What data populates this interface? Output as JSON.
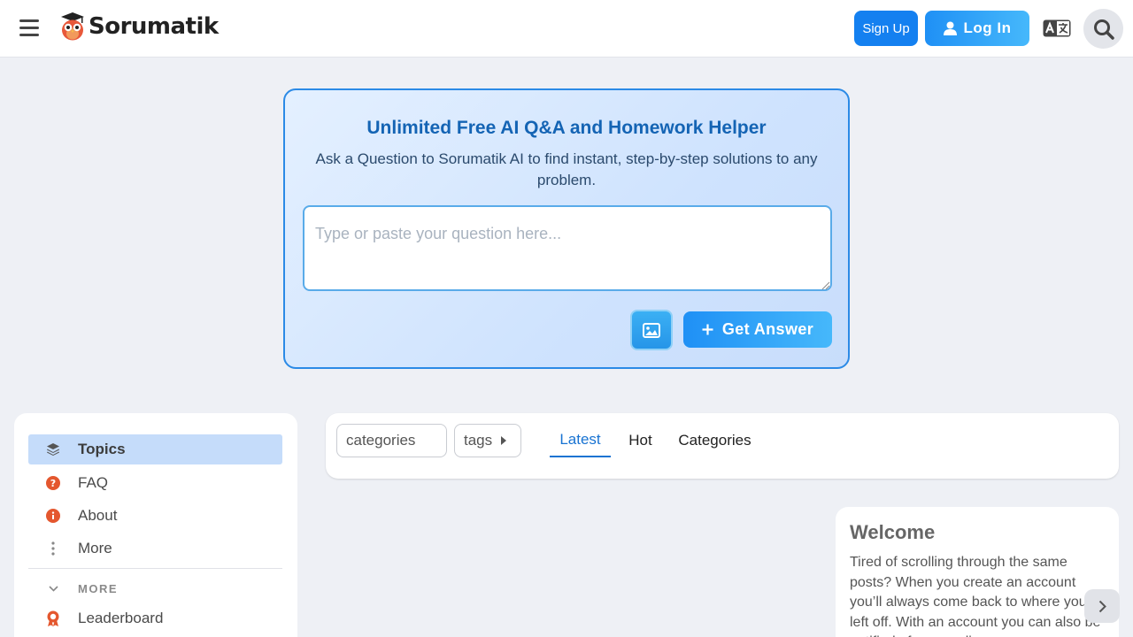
{
  "header": {
    "brand": "Sorumatik",
    "signup_label": "Sign Up",
    "login_label": "Log In",
    "icons": [
      "menu-icon",
      "owl-logo-icon",
      "user-icon",
      "translate-icon",
      "search-icon"
    ]
  },
  "hero": {
    "title": "Unlimited Free AI Q&A and Homework Helper",
    "subtitle": "Ask a Question to Sorumatik AI to find instant, step-by-step solutions to any problem.",
    "placeholder": "Type or paste your question here...",
    "value": "",
    "answer_label": "Get Answer",
    "icons": [
      "image-icon",
      "plus-icon"
    ]
  },
  "sidebar": {
    "items": [
      {
        "label": "Topics",
        "icon": "layers-icon",
        "active": true
      },
      {
        "label": "FAQ",
        "icon": "question-circle-icon"
      },
      {
        "label": "About",
        "icon": "info-circle-icon"
      },
      {
        "label": "More",
        "icon": "vertical-dots-icon"
      }
    ],
    "more_section_label": "MORE",
    "more_items": [
      {
        "label": "Leaderboard",
        "icon": "award-icon"
      }
    ]
  },
  "filters": {
    "categories_label": "categories",
    "tags_label": "tags",
    "tabs": [
      {
        "label": "Latest",
        "active": true
      },
      {
        "label": "Hot"
      },
      {
        "label": "Categories"
      }
    ]
  },
  "welcome": {
    "title": "Welcome",
    "text": "Tired of scrolling through the same posts? When you create an account you’ll always come back to where you left off. With an account you can also be notified of new replies"
  },
  "colors": {
    "accent": "#1480f0",
    "hero_title": "#1464b4",
    "active_tab": "#1873d2",
    "sidebar_active": "#c5dcfa",
    "page_bg": "#eef0f5"
  }
}
